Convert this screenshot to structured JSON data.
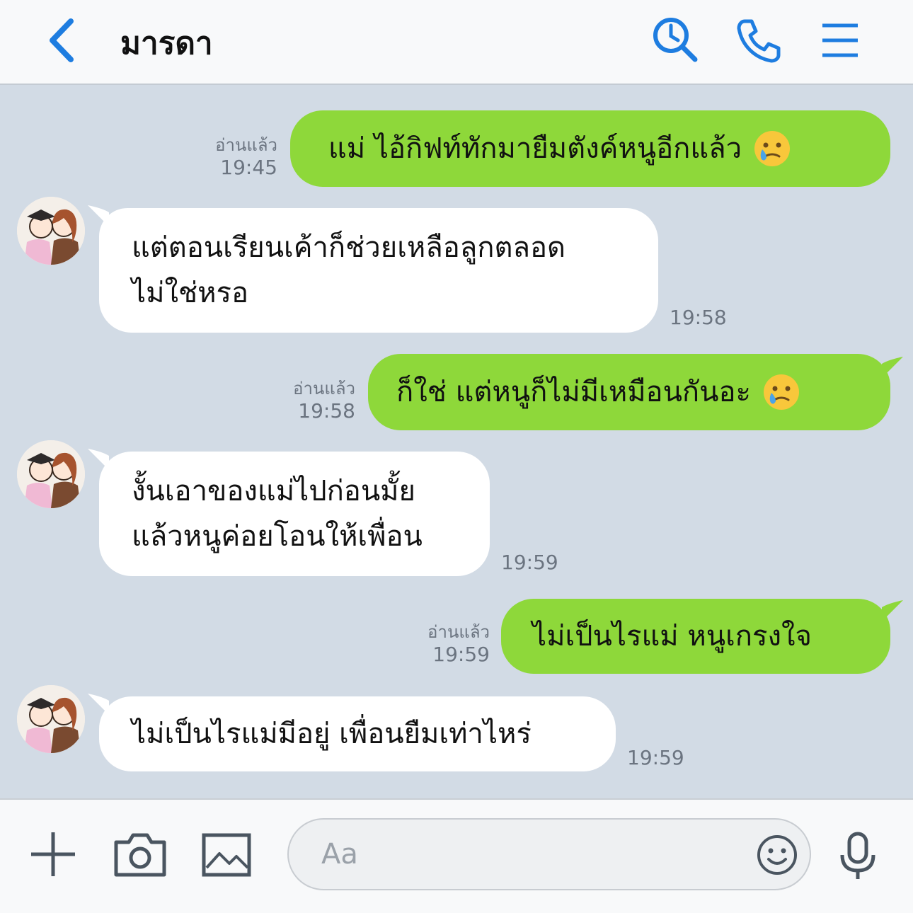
{
  "header": {
    "title": "มารดา",
    "icons": [
      "back-chevron-icon",
      "search-icon",
      "phone-icon",
      "menu-icon"
    ],
    "accent": "#1e7de0"
  },
  "colors": {
    "outgoing": "#8ed83a",
    "incoming": "#ffffff",
    "background": "#d2dbe5"
  },
  "messages": [
    {
      "dir": "out",
      "text": "แม่ ไอ้กิฟท์ทักมายืมตังค์หนูอีกแล้ว",
      "emoji": "crying-face-icon",
      "read": "อ่านแล้ว",
      "time": "19:45"
    },
    {
      "dir": "in",
      "text": "แต่ตอนเรียนเค้าก็ช่วยเหลือลูกตลอด\nไม่ใช่หรอ",
      "time": "19:58"
    },
    {
      "dir": "out",
      "text": "ก็ใช่ แต่หนูก็ไม่มีเหมือนกันอะ",
      "emoji": "crying-face-icon",
      "read": "อ่านแล้ว",
      "time": "19:58"
    },
    {
      "dir": "in",
      "text": "งั้นเอาของแม่ไปก่อนมั้ย\nแล้วหนูค่อยโอนให้เพื่อน",
      "time": "19:59"
    },
    {
      "dir": "out",
      "text": "ไม่เป็นไรแม่ หนูเกรงใจ",
      "read": "อ่านแล้ว",
      "time": "19:59"
    },
    {
      "dir": "in",
      "text": "ไม่เป็นไรแม่มีอยู่ เพื่อนยืมเท่าไหร่",
      "time": "19:59"
    }
  ],
  "footer": {
    "input_placeholder": "Aa",
    "icons": [
      "plus-icon",
      "camera-icon",
      "image-icon",
      "emoji-icon",
      "microphone-icon"
    ]
  }
}
